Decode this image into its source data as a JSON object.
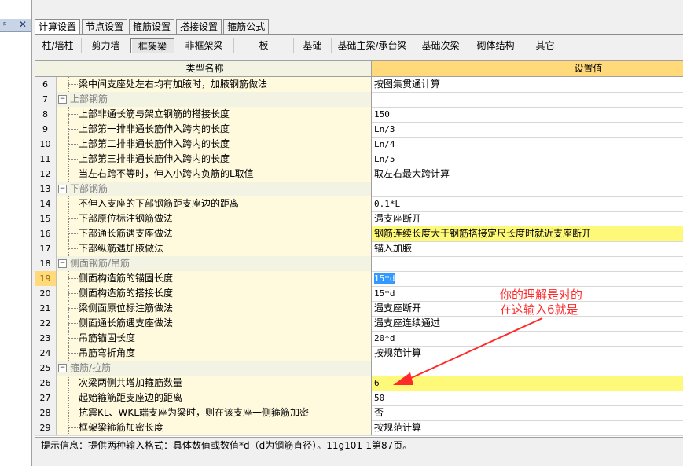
{
  "panel": {
    "pin_icon": "pin-icon",
    "close_icon": "close-icon",
    "close_glyph": "✕",
    "pin_glyph": "ᵖ"
  },
  "top_tabs": [
    "计算设置",
    "节点设置",
    "箍筋设置",
    "搭接设置",
    "箍筋公式"
  ],
  "active_top_tab": 0,
  "sub_tabs": [
    "柱/墙柱",
    "剪力墙",
    "框架梁",
    "非框架梁",
    "板",
    "基础",
    "基础主梁/承台梁",
    "基础次梁",
    "砌体结构",
    "其它"
  ],
  "active_sub_tab": 2,
  "grid": {
    "col_name": "类型名称",
    "col_value": "设置值",
    "rows": [
      {
        "num": "6",
        "type": "item",
        "name": "梁中间支座处左右均有加腋时，加腋钢筋做法",
        "value": "按图集贯通计算",
        "mono": false
      },
      {
        "num": "7",
        "type": "group",
        "name": "上部钢筋",
        "value": "",
        "mono": false
      },
      {
        "num": "8",
        "type": "item",
        "name": "上部非通长筋与架立钢筋的搭接长度",
        "value": "150",
        "mono": true
      },
      {
        "num": "9",
        "type": "item",
        "name": "上部第一排非通长筋伸入跨内的长度",
        "value": "Ln/3",
        "mono": true
      },
      {
        "num": "10",
        "type": "item",
        "name": "上部第二排非通长筋伸入跨内的长度",
        "value": "Ln/4",
        "mono": true
      },
      {
        "num": "11",
        "type": "item",
        "name": "上部第三排非通长筋伸入跨内的长度",
        "value": "Ln/5",
        "mono": true
      },
      {
        "num": "12",
        "type": "item",
        "name": "当左右跨不等时，伸入小跨内负筋的L取值",
        "value": "取左右最大跨计算",
        "mono": false
      },
      {
        "num": "13",
        "type": "group",
        "name": "下部钢筋",
        "value": "",
        "mono": false
      },
      {
        "num": "14",
        "type": "item",
        "name": "不伸入支座的下部钢筋距支座边的距离",
        "value": "0.1*L",
        "mono": true
      },
      {
        "num": "15",
        "type": "item",
        "name": "下部原位标注钢筋做法",
        "value": "遇支座断开",
        "mono": false
      },
      {
        "num": "16",
        "type": "item",
        "name": "下部通长筋遇支座做法",
        "value": "钢筋连续长度大于钢筋搭接定尺长度时就近支座断开",
        "mono": false,
        "highlight": true
      },
      {
        "num": "17",
        "type": "item",
        "name": "下部纵筋遇加腋做法",
        "value": "锚入加腋",
        "mono": false
      },
      {
        "num": "18",
        "type": "group",
        "name": "侧面钢筋/吊筋",
        "value": "",
        "mono": false
      },
      {
        "num": "19",
        "type": "item",
        "name": "侧面构造筋的锚固长度",
        "value": "15*d",
        "mono": true,
        "current": true,
        "selected": true
      },
      {
        "num": "20",
        "type": "item",
        "name": "侧面构造筋的搭接长度",
        "value": "15*d",
        "mono": true
      },
      {
        "num": "21",
        "type": "item",
        "name": "梁侧面原位标注筋做法",
        "value": "遇支座断开",
        "mono": false
      },
      {
        "num": "22",
        "type": "item",
        "name": "侧面通长筋遇支座做法",
        "value": "遇支座连续通过",
        "mono": false
      },
      {
        "num": "23",
        "type": "item",
        "name": "吊筋锚固长度",
        "value": "20*d",
        "mono": true
      },
      {
        "num": "24",
        "type": "item",
        "name": "吊筋弯折角度",
        "value": "按规范计算",
        "mono": false
      },
      {
        "num": "25",
        "type": "group",
        "name": "箍筋/拉筋",
        "value": "",
        "mono": false
      },
      {
        "num": "26",
        "type": "item",
        "name": "次梁两侧共增加箍筋数量",
        "value": "6",
        "mono": true,
        "highlight": true
      },
      {
        "num": "27",
        "type": "item",
        "name": "起始箍筋距支座边的距离",
        "value": "50",
        "mono": true
      },
      {
        "num": "28",
        "type": "item",
        "name": "抗震KL、WKL端支座为梁时，则在该支座一侧箍筋加密",
        "value": "否",
        "mono": false
      },
      {
        "num": "29",
        "type": "item",
        "name": "框架梁箍筋加密长度",
        "value": "按规范计算",
        "mono": false
      }
    ]
  },
  "status": "提示信息：提供两种输入格式：具体数值或数值*d（d为钢筋直径）。11g101-1第87页。",
  "annotation": {
    "line1": "你的理解是对的",
    "line2": "在这输入6就是",
    "color": "#ff2a2a"
  },
  "colors": {
    "header_value_bg": "#ffd97a",
    "highlight_bg": "#fff97a",
    "name_bg": "#fff9de",
    "selection": "#3399ff"
  }
}
